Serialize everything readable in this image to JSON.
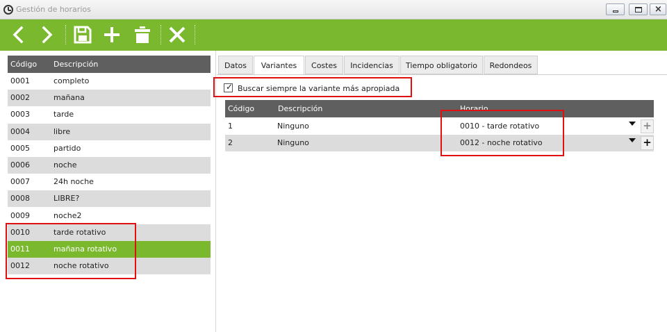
{
  "window": {
    "title": "Gestión de horarios"
  },
  "toolbar": {
    "buttons": [
      "back-icon",
      "forward-icon",
      "save-icon",
      "add-icon",
      "delete-icon",
      "cancel-icon"
    ],
    "accent": "#7ab82e"
  },
  "left_table": {
    "headers": {
      "code": "Código",
      "description": "Descripción"
    },
    "rows": [
      {
        "code": "0001",
        "description": "completo"
      },
      {
        "code": "0002",
        "description": "mañana"
      },
      {
        "code": "0003",
        "description": "tarde"
      },
      {
        "code": "0004",
        "description": "libre"
      },
      {
        "code": "0005",
        "description": "partido"
      },
      {
        "code": "0006",
        "description": "noche"
      },
      {
        "code": "0007",
        "description": "24h noche"
      },
      {
        "code": "0008",
        "description": "LIBRE?"
      },
      {
        "code": "0009",
        "description": "noche2"
      },
      {
        "code": "0010",
        "description": "tarde rotativo"
      },
      {
        "code": "0011",
        "description": "mañana rotativo"
      },
      {
        "code": "0012",
        "description": "noche rotativo"
      }
    ],
    "selected_code": "0011"
  },
  "tabs": [
    {
      "label": "Datos"
    },
    {
      "label": "Variantes"
    },
    {
      "label": "Costes"
    },
    {
      "label": "Incidencias"
    },
    {
      "label": "Tiempo obligatorio"
    },
    {
      "label": "Redondeos"
    }
  ],
  "active_tab": "Variantes",
  "variants": {
    "always_best_label": "Buscar siempre la variante más apropiada",
    "always_best_checked": true,
    "headers": {
      "code": "Código",
      "description": "Descripción",
      "schedule": "Horario"
    },
    "rows": [
      {
        "code": "1",
        "description": "Ninguno",
        "schedule": "0010 - tarde rotativo"
      },
      {
        "code": "2",
        "description": "Ninguno",
        "schedule": "0012 - noche rotativo"
      }
    ],
    "add_glyph": "+"
  }
}
